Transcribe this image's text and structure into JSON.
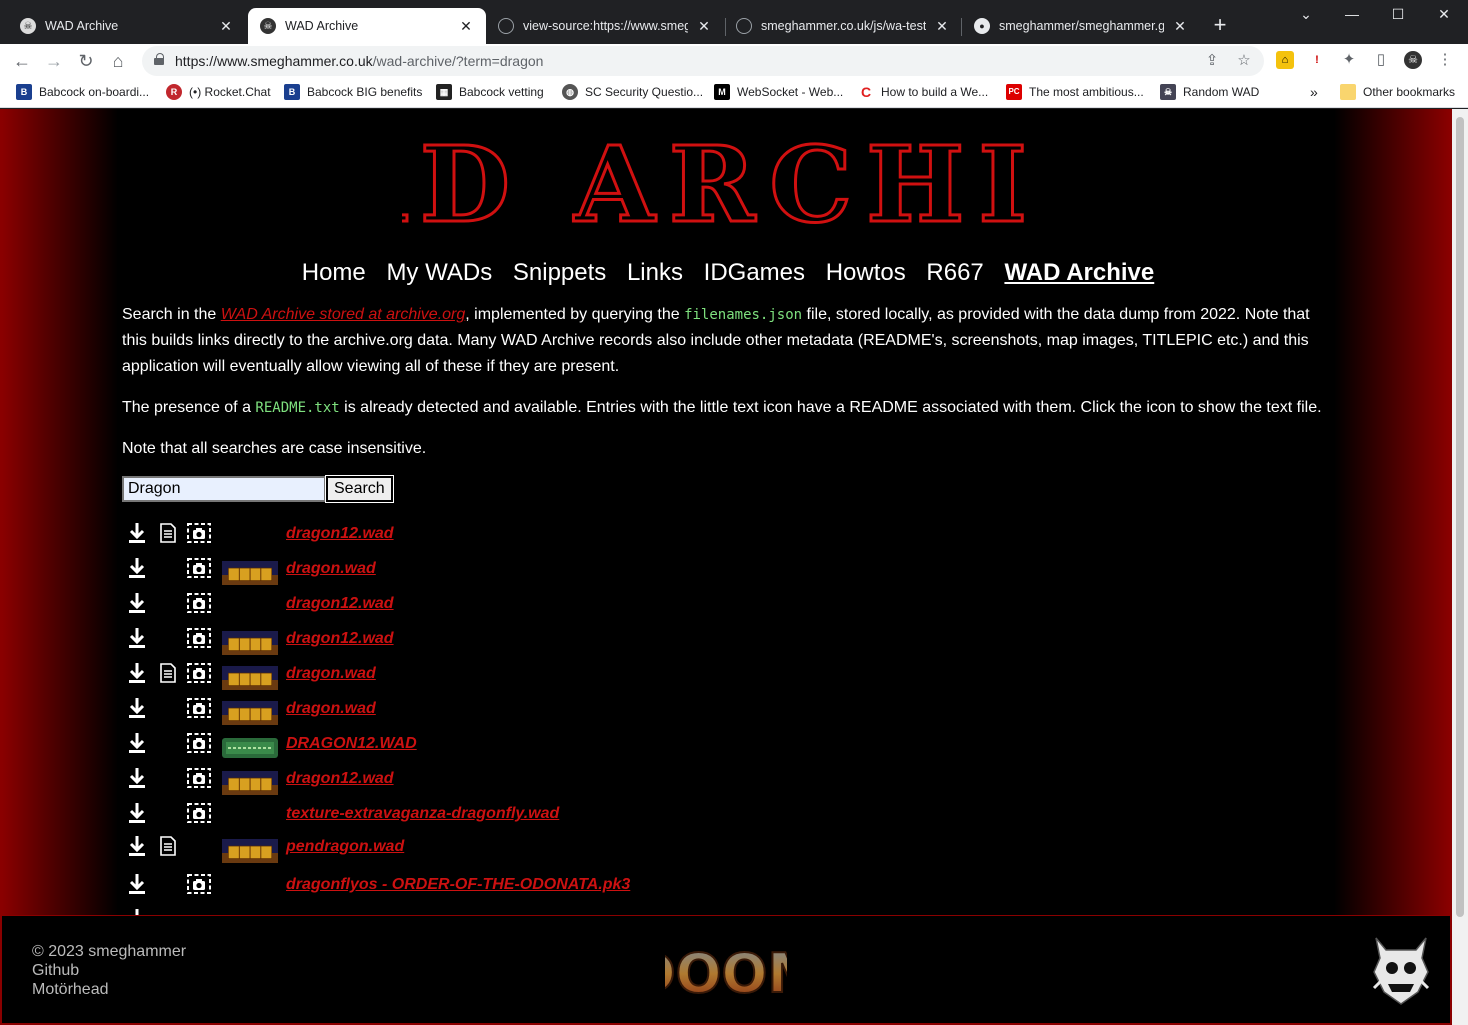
{
  "browser": {
    "tabs": [
      {
        "title": "WAD Archive",
        "active": false,
        "icon": "skull-icon"
      },
      {
        "title": "WAD Archive",
        "active": true,
        "icon": "skull-icon"
      },
      {
        "title": "view-source:https://www.smegha",
        "active": false,
        "icon": "globe-icon"
      },
      {
        "title": "smeghammer.co.uk/js/wa-test.js",
        "active": false,
        "icon": "globe-icon"
      },
      {
        "title": "smeghammer/smeghammer.githu",
        "active": false,
        "icon": "github-icon"
      }
    ],
    "url_host": "https://www.smeghammer.co.uk",
    "url_path": "/wad-archive/?term=dragon",
    "bookmarks": [
      "Babcock on-boardi...",
      "(•) Rocket.Chat",
      "Babcock BIG benefits",
      "Babcock vetting",
      "SC Security Questio...",
      "WebSocket - Web...",
      "How to build a We...",
      "The most ambitious...",
      "Random WAD"
    ],
    "other_bookmarks": "Other bookmarks",
    "more_bookmarks": "»"
  },
  "site": {
    "logo_text": "WAD ARCHIVE",
    "nav": [
      {
        "label": "Home",
        "current": false
      },
      {
        "label": "My WADs",
        "current": false
      },
      {
        "label": "Snippets",
        "current": false
      },
      {
        "label": "Links",
        "current": false
      },
      {
        "label": "IDGames",
        "current": false
      },
      {
        "label": "Howtos",
        "current": false
      },
      {
        "label": "R667",
        "current": false
      },
      {
        "label": "WAD Archive",
        "current": true
      }
    ],
    "intro": {
      "p1_a": "Search in the ",
      "p1_link": "WAD Archive stored at archive.org",
      "p1_b": ", implemented by querying the ",
      "p1_code": "filenames.json",
      "p1_c": " file, stored locally, as provided with the data dump from 2022. Note that this builds links directly to the archive.org data. Many WAD Archive records also include other metadata (README's, screenshots, map images, TITLEPIC etc.) and this application will eventually allow viewing all of these if they are present.",
      "p2_a": "The presence of a ",
      "p2_code": "README.txt",
      "p2_b": " is already detected and available. Entries with the little text icon have a README associated with them. Click the icon to show the text file.",
      "p3": "Note that all searches are case insensitive."
    },
    "search": {
      "value": "Dragon",
      "button": "Search"
    },
    "results": [
      {
        "name": "dragon12.wad",
        "readme": true,
        "shot": true,
        "titlepic": "none"
      },
      {
        "name": "dragon.wad",
        "readme": false,
        "shot": true,
        "titlepic": "doom"
      },
      {
        "name": "dragon12.wad",
        "readme": false,
        "shot": true,
        "titlepic": "none"
      },
      {
        "name": "dragon12.wad",
        "readme": false,
        "shot": true,
        "titlepic": "doom"
      },
      {
        "name": "dragon.wad",
        "readme": true,
        "shot": true,
        "titlepic": "doom"
      },
      {
        "name": "dragon.wad",
        "readme": false,
        "shot": true,
        "titlepic": "doom"
      },
      {
        "name": "DRAGON12.WAD",
        "readme": false,
        "shot": true,
        "titlepic": "heretic"
      },
      {
        "name": "dragon12.wad",
        "readme": false,
        "shot": true,
        "titlepic": "doom"
      },
      {
        "name": "texture-extravaganza-dragonfly.wad",
        "readme": false,
        "shot": true,
        "titlepic": "none"
      },
      {
        "name": "pendragon.wad",
        "readme": true,
        "shot": false,
        "titlepic": "doom"
      },
      {
        "name": "dragonflyos - ORDER-OF-THE-ODONATA.pk3",
        "readme": false,
        "shot": true,
        "titlepic": "none"
      }
    ],
    "footer": {
      "copyright": "© 2023 smeghammer",
      "links": [
        "Github",
        "Motörhead"
      ],
      "doom_logo_text": "DOOM"
    },
    "colors": {
      "accent_red": "#cc1111",
      "dark_red": "#8a0000",
      "code_green": "#7ee07e"
    }
  }
}
